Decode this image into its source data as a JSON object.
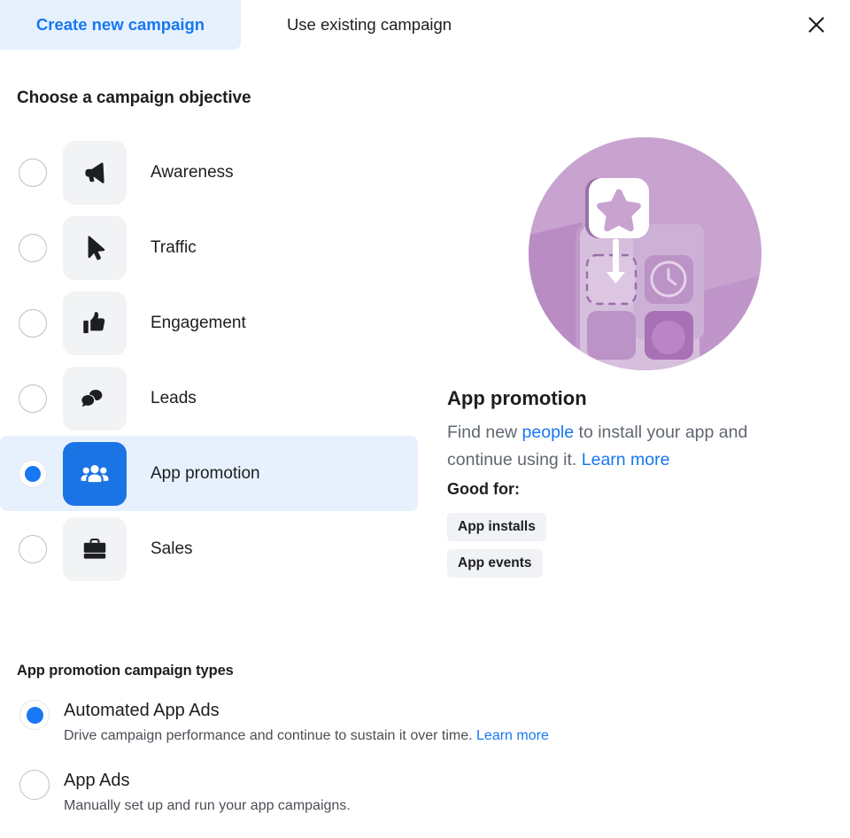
{
  "tabs": [
    {
      "label": "Create new campaign",
      "active": true,
      "name": "tab-create-new-campaign"
    },
    {
      "label": "Use existing campaign",
      "active": false,
      "name": "tab-use-existing-campaign"
    }
  ],
  "close_icon": "close-icon",
  "objective_section": {
    "title": "Choose a campaign objective",
    "items": [
      {
        "label": "Awareness",
        "icon": "megaphone-icon",
        "selected": false
      },
      {
        "label": "Traffic",
        "icon": "cursor-icon",
        "selected": false
      },
      {
        "label": "Engagement",
        "icon": "thumbs-up-icon",
        "selected": false
      },
      {
        "label": "Leads",
        "icon": "speech-bubbles-icon",
        "selected": false
      },
      {
        "label": "App promotion",
        "icon": "people-group-icon",
        "selected": true
      },
      {
        "label": "Sales",
        "icon": "briefcase-icon",
        "selected": false
      }
    ]
  },
  "preview": {
    "illustration": "app-install-illustration",
    "heading": "App promotion",
    "description_before_link": "Find new ",
    "description_link": "people",
    "description_middle": " to install your app and continue using it. ",
    "description_learn_more": "Learn more",
    "good_for_label": "Good for:",
    "tags": [
      "App installs",
      "App events"
    ]
  },
  "types_section": {
    "title": "App promotion campaign types",
    "items": [
      {
        "name": "Automated App Ads",
        "description": "Drive campaign performance and continue to sustain it over time.",
        "learn_more": "Learn more",
        "selected": true
      },
      {
        "name": "App Ads",
        "description": "Manually set up and run your app campaigns.",
        "learn_more": "",
        "selected": false
      }
    ]
  },
  "colors": {
    "accent_blue": "#1877f2",
    "selected_row_bg": "#e7f1fe",
    "icon_box_bg": "#f2f3f5",
    "tag_bg": "#f0f2f5",
    "illustration_purple": "#c39ccb",
    "text_primary": "#1c1e21",
    "text_secondary": "#606770"
  }
}
